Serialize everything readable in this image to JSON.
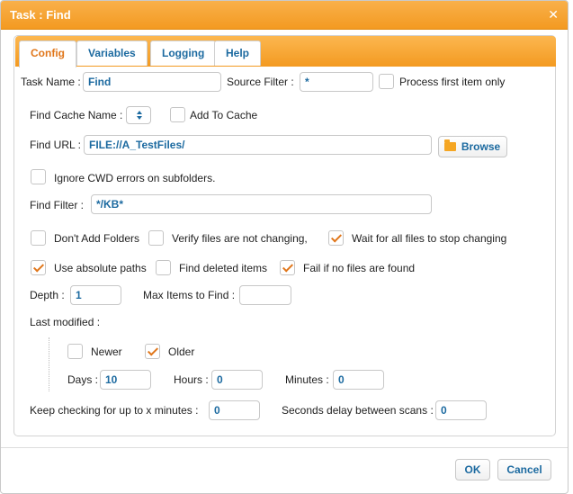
{
  "dialog": {
    "title": "Task : Find",
    "close_glyph": "✕"
  },
  "tabs": [
    "Config",
    "Variables",
    "Logging",
    "Help"
  ],
  "active_tab": "Config",
  "fields": {
    "task_name_label": "Task Name :",
    "task_name_value": "Find",
    "source_filter_label": "Source Filter :",
    "source_filter_value": "*",
    "process_first_label": "Process first item only",
    "find_cache_label": "Find Cache Name :",
    "add_to_cache_label": "Add To Cache",
    "find_url_label": "Find URL :",
    "find_url_value": "FILE://A_TestFiles/",
    "browse_label": "Browse",
    "ignore_cwd_label": "Ignore CWD errors on subfolders.",
    "find_filter_label": "Find Filter :",
    "find_filter_value": "*/KB*",
    "dont_add_folders_label": "Don't Add Folders",
    "verify_files_label": "Verify files are not changing,",
    "wait_all_label": "Wait for all files to stop changing",
    "absolute_paths_label": "Use absolute paths",
    "find_deleted_label": "Find deleted items",
    "fail_if_none_label": "Fail if no files are found",
    "depth_label": "Depth :",
    "depth_value": "1",
    "max_items_label": "Max Items to Find :",
    "max_items_value": "",
    "last_modified_label": "Last modified :",
    "newer_label": "Newer",
    "older_label": "Older",
    "days_label": "Days :",
    "days_value": "10",
    "hours_label": "Hours :",
    "hours_value": "0",
    "minutes_label": "Minutes :",
    "minutes_value": "0",
    "keep_checking_label": "Keep checking for up to x minutes :",
    "keep_checking_value": "0",
    "seconds_delay_label": "Seconds delay between scans :",
    "seconds_delay_value": "0"
  },
  "checks": {
    "process_first": false,
    "add_to_cache": false,
    "ignore_cwd": false,
    "dont_add_folders": false,
    "verify_files": false,
    "wait_all": true,
    "absolute_paths": true,
    "find_deleted": false,
    "fail_if_none": true,
    "newer": false,
    "older": true
  },
  "footer": {
    "ok_label": "OK",
    "cancel_label": "Cancel"
  },
  "colors": {
    "accent": "#f39a21",
    "link": "#1c6aa0",
    "active_tab": "#e0761a"
  }
}
